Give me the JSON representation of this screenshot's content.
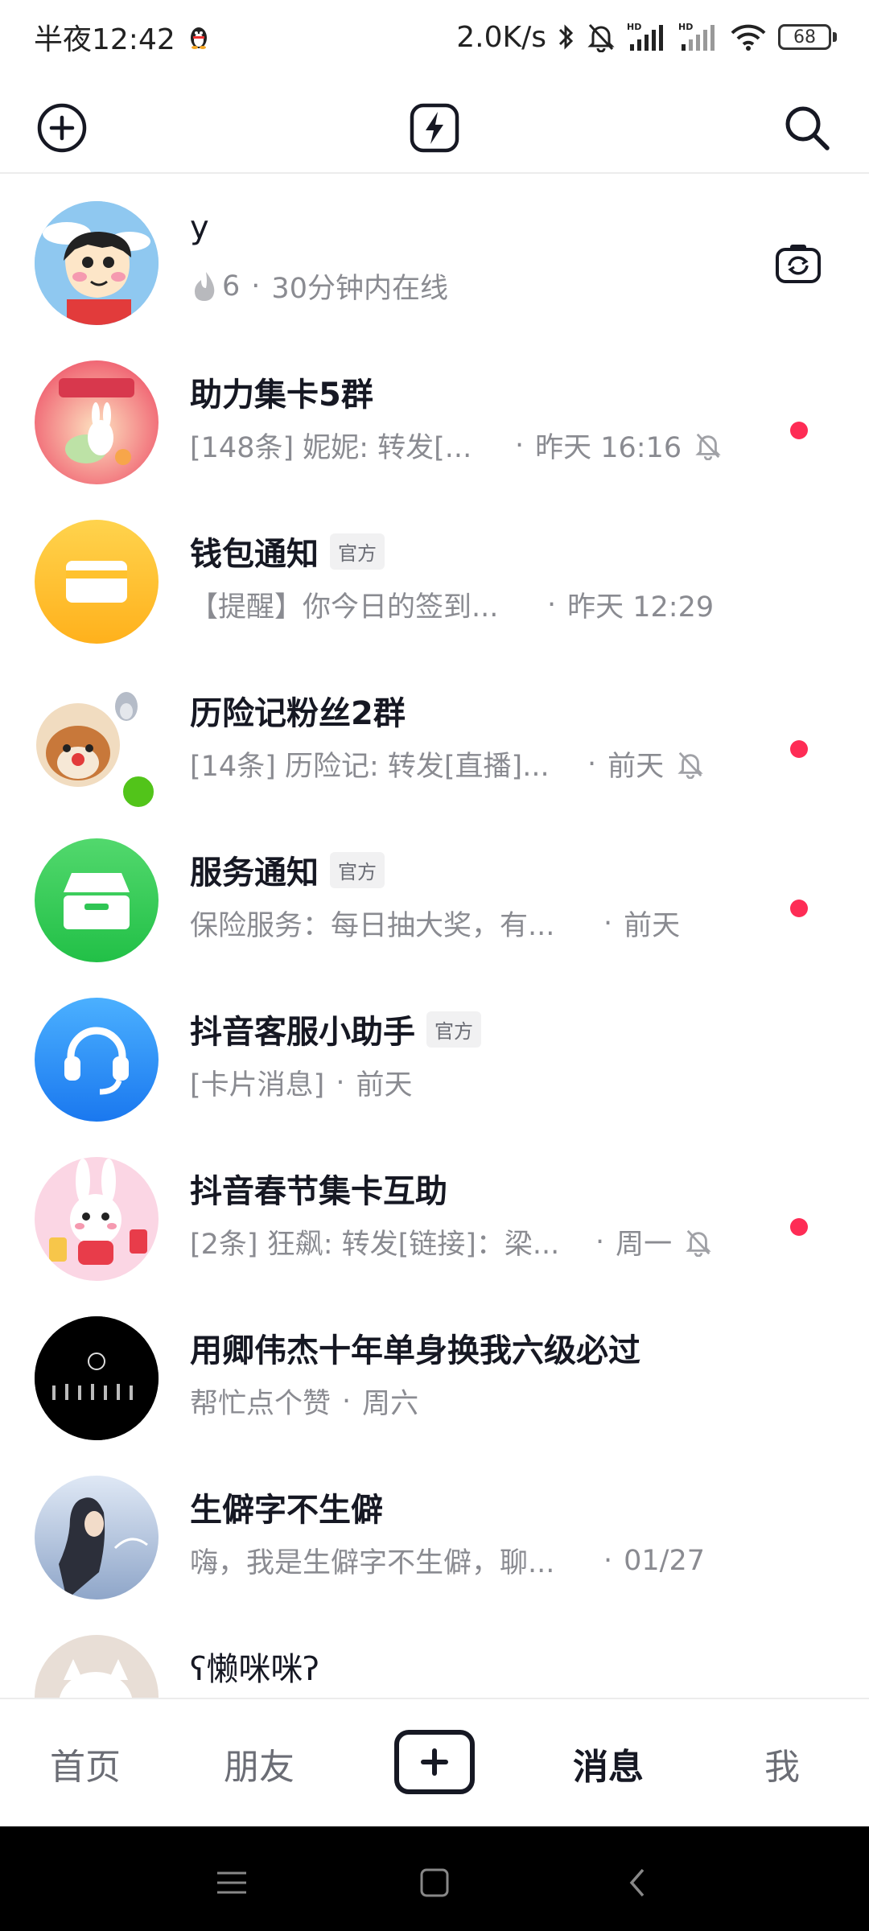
{
  "status_bar": {
    "time": "半夜12:42",
    "net_speed": "2.0K/s",
    "battery": "68"
  },
  "top_bar": {
    "icons": [
      "add-circle-icon",
      "flash-icon",
      "search-icon"
    ]
  },
  "chats": [
    {
      "name": "y",
      "sub_prefix": "6",
      "sub_status": "30分钟内在线",
      "avatar_colors": [
        "#8ec5ef",
        "#3a7cc7"
      ]
    },
    {
      "name": "助力集卡5群",
      "preview": "[148条] 妮妮: 转发[...",
      "time": "昨天 16:16",
      "muted": true,
      "unread": true,
      "avatar_colors": [
        "#f7c6c6",
        "#e65c6e"
      ]
    },
    {
      "name": "钱包通知",
      "badge": "官方",
      "preview": "【提醒】你今日的签到...",
      "time": "昨天 12:29",
      "avatar_colors": [
        "#ffd24a",
        "#ffb21e"
      ]
    },
    {
      "name": "历险记粉丝2群",
      "preview": "[14条] 历险记: 转发[直播]...",
      "time": "前天",
      "muted": true,
      "unread": true,
      "online": true,
      "avatar_colors": [
        "#f3d9b5",
        "#c07a3a"
      ]
    },
    {
      "name": "服务通知",
      "badge": "官方",
      "preview": "保险服务：每日抽大奖，有...",
      "time": "前天",
      "unread": true,
      "avatar_colors": [
        "#4fd66b",
        "#25c24a"
      ]
    },
    {
      "name": "抖音客服小助手",
      "badge": "官方",
      "preview": "[卡片消息]",
      "time": "前天",
      "avatar_colors": [
        "#45a9ff",
        "#1e7bf0"
      ]
    },
    {
      "name": "抖音春节集卡互助",
      "preview": "[2条] 狂飙: 转发[链接]：梁...",
      "time": "周一",
      "muted": true,
      "unread": true,
      "avatar_colors": [
        "#fbd3e2",
        "#e85a6a"
      ]
    },
    {
      "name": "用卿伟杰十年单身换我六级必过",
      "preview": "帮忙点个赞",
      "time": "周六",
      "avatar_colors": [
        "#111111",
        "#000000"
      ]
    },
    {
      "name": "生僻字不生僻",
      "preview": "嗨，我是生僻字不生僻，聊...",
      "time": "01/27",
      "avatar_colors": [
        "#c5d6ec",
        "#5a6c93"
      ]
    },
    {
      "name": "ʕ懒咪咪ʔ",
      "avatar_colors": [
        "#efe6e0",
        "#c9b2a4"
      ]
    }
  ],
  "bottom_nav": {
    "home": "首页",
    "friends": "朋友",
    "messages": "消息",
    "me": "我"
  },
  "colors": {
    "unread_dot": "#fe2c55",
    "online": "#52c41a",
    "text_primary": "#161823",
    "text_secondary": "#8a8b91"
  }
}
